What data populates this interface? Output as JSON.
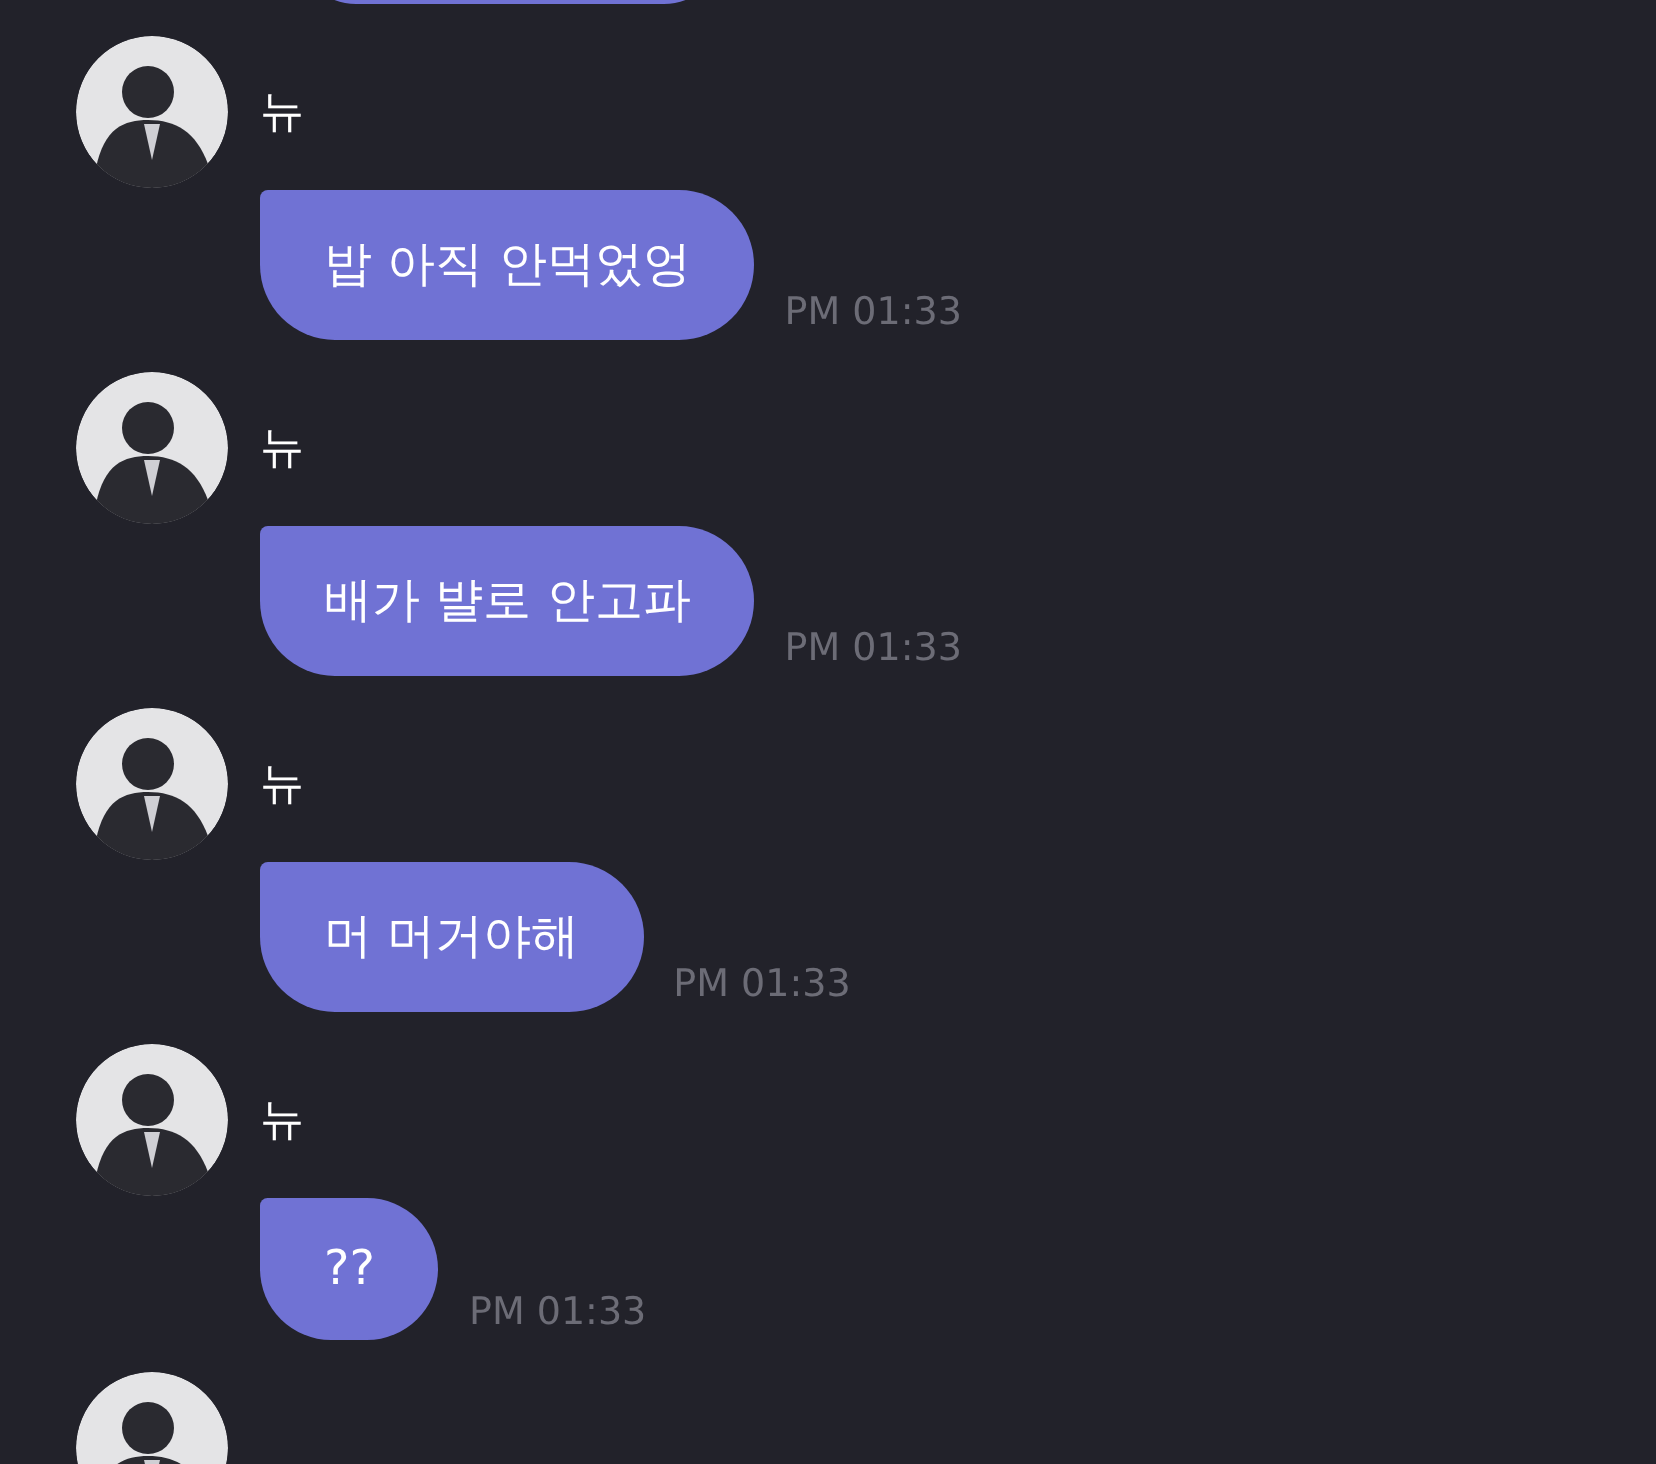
{
  "messages": [
    {
      "sender": "뉴",
      "text": "밥 아직 안먹었엉",
      "time": "PM 01:33"
    },
    {
      "sender": "뉴",
      "text": "배가 뱔로 안고파",
      "time": "PM 01:33"
    },
    {
      "sender": "뉴",
      "text": "머 머거야해",
      "time": "PM 01:33"
    },
    {
      "sender": "뉴",
      "text": "??",
      "time": "PM 01:33"
    }
  ]
}
